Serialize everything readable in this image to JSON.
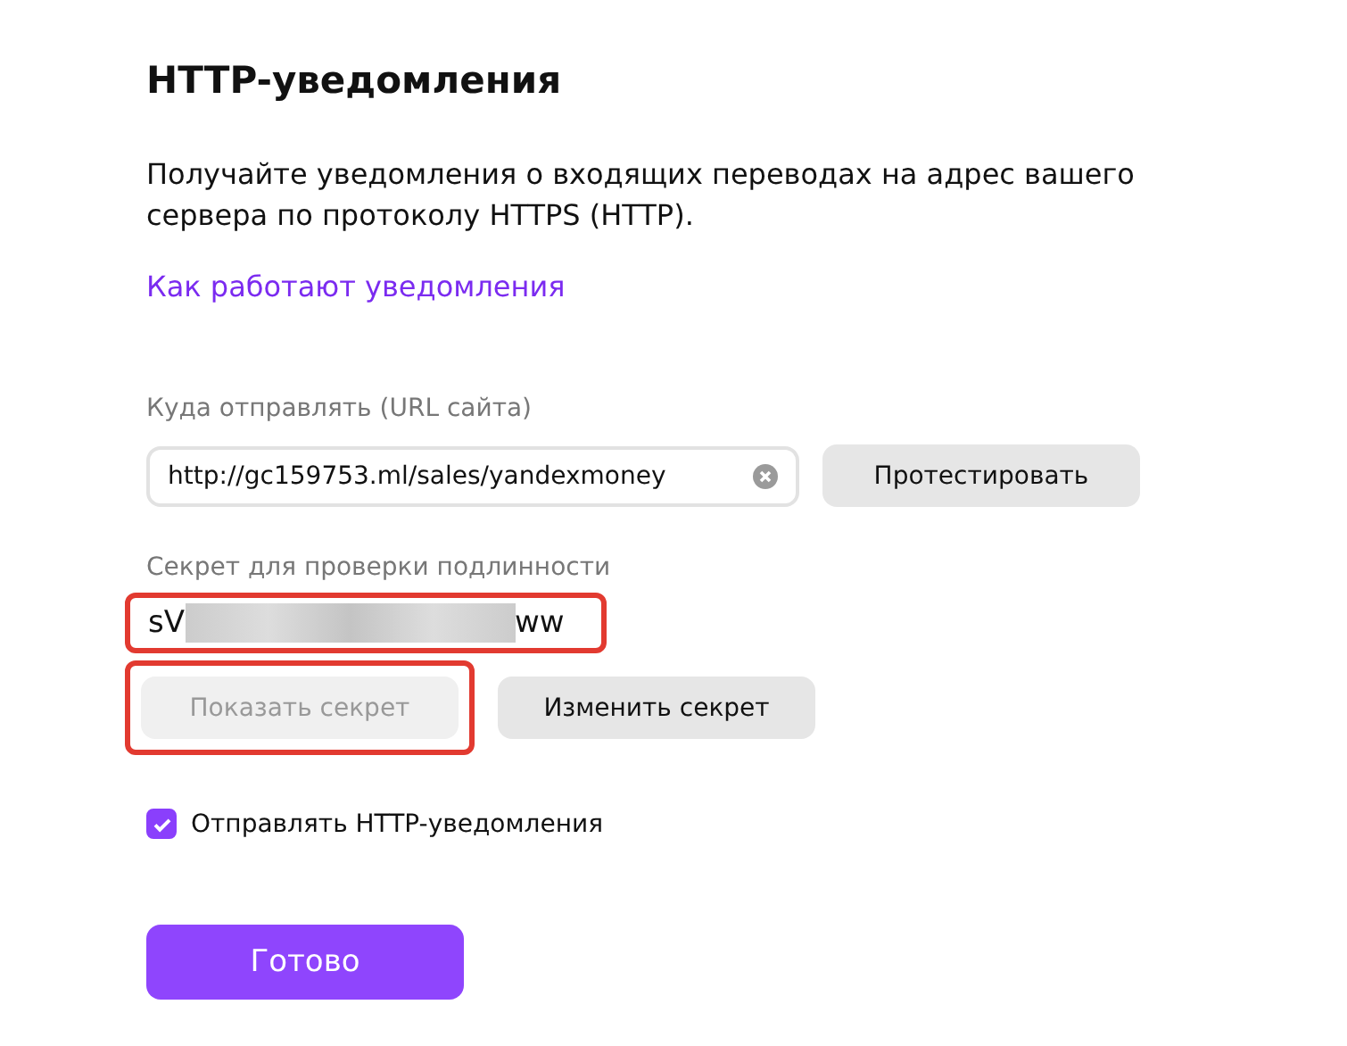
{
  "title": "HTTP-уведомления",
  "description": "Получайте уведомления о входящих переводах на адрес вашего сервера по протоколу HTTPS (HTTP).",
  "help_link": "Как работают уведомления",
  "url_field": {
    "label": "Куда отправлять (URL сайта)",
    "value": "http://gc159753.ml/sales/yandexmoney"
  },
  "test_button": {
    "label": "Протестировать"
  },
  "secret_field": {
    "label": "Секрет для проверки подлинности",
    "start": "sV",
    "end": "ww",
    "highlighted": true
  },
  "show_secret_button": {
    "label": "Показать секрет",
    "disabled": true,
    "highlighted": true
  },
  "change_secret_button": {
    "label": "Изменить секрет",
    "disabled": false,
    "highlighted": false
  },
  "send_checkbox": {
    "label": "Отправлять HTTP-уведомления",
    "checked": true
  },
  "done_button": {
    "label": "Готово"
  }
}
